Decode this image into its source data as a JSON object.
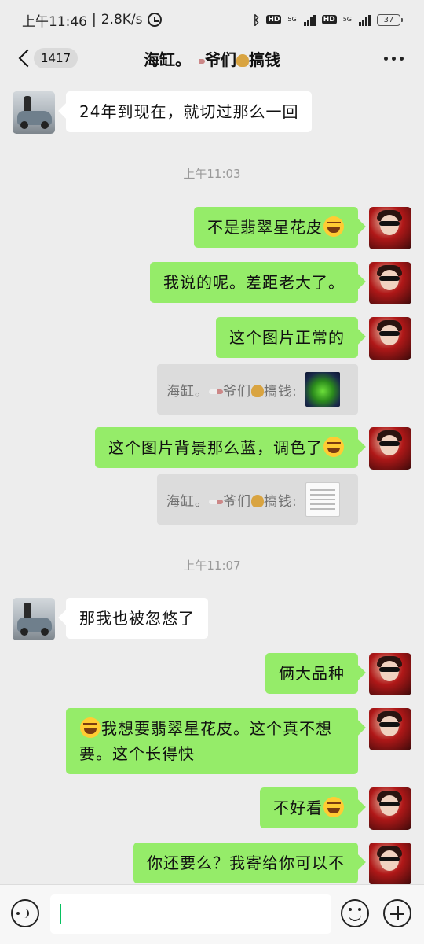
{
  "status_bar": {
    "time": "上午11:46",
    "net_speed": "2.8K/s",
    "network_1": "5G",
    "network_2": "5G",
    "hd_label": "HD",
    "battery": "37"
  },
  "header": {
    "unread_count": "1417",
    "title_part1": "海缸。",
    "title_part2": "爷们",
    "title_part3": "搞钱"
  },
  "messages": [
    {
      "side": "left",
      "text": "24年到现在，就切过那么一回"
    },
    {
      "type": "time",
      "text": "上午11:03"
    },
    {
      "side": "right",
      "text": "不是翡翠星花皮"
    },
    {
      "side": "right",
      "text": "我说的呢。差距老大了。"
    },
    {
      "side": "right",
      "text": "这个图片正常的"
    },
    {
      "type": "quote",
      "text_a": "海缸。",
      "text_b": "爷们",
      "text_c": "搞钱:"
    },
    {
      "side": "right",
      "text": "这个图片背景那么蓝，调色了"
    },
    {
      "type": "quote",
      "text_a": "海缸。",
      "text_b": "爷们",
      "text_c": "搞钱:"
    },
    {
      "type": "time",
      "text": "上午11:07"
    },
    {
      "side": "left",
      "text": "那我也被忽悠了"
    },
    {
      "side": "right",
      "text": "俩大品种"
    },
    {
      "side": "right",
      "text_line1": "我想要翡翠星花皮。这个真不想",
      "text_line2": "要。这个长得快"
    },
    {
      "side": "right",
      "text": "不好看"
    },
    {
      "side": "right",
      "text": "你还要么？我寄给你可以不"
    }
  ],
  "input": {
    "value": ""
  },
  "icons": {
    "back": "chevron-left-icon",
    "more": "more-dots-icon",
    "voice": "voice-icon",
    "emoji": "emoji-icon",
    "plus": "plus-icon"
  },
  "colors": {
    "chat_bg": "#ededed",
    "bubble_self": "#95ec69",
    "bubble_other": "#ffffff"
  }
}
